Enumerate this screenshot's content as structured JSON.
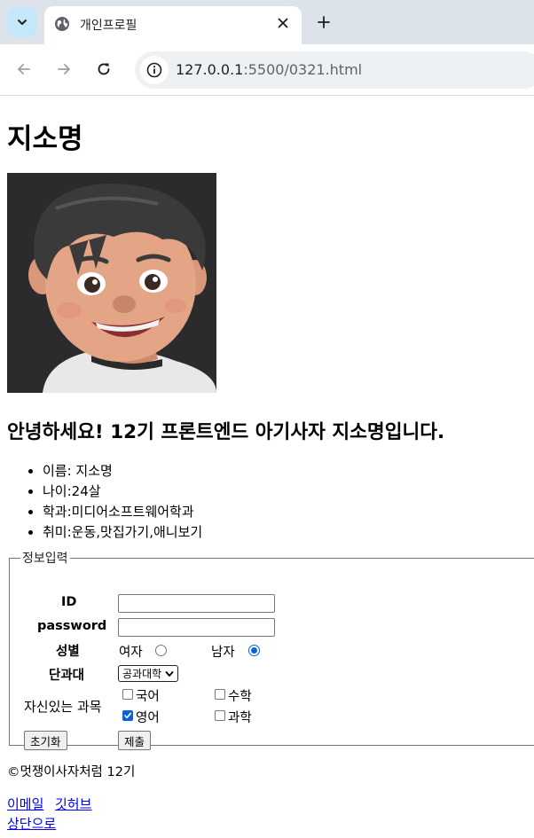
{
  "browser": {
    "tab_title": "개인프로필",
    "url_host": "127.0.0.1",
    "url_rest": ":5500/0321.html"
  },
  "profile": {
    "name": "지소명",
    "greeting": "안녕하세요! 12기 프론트엔드 아기사자 지소명입니다.",
    "info": [
      "이름: 지소명",
      "나이:24살",
      "학과:미디어소프트웨어학과",
      "취미:운동,맛집가기,애니보기"
    ]
  },
  "form": {
    "legend": "정보입력",
    "id_label": "ID",
    "id_value": "",
    "password_label": "password",
    "password_value": "",
    "gender_label": "성별",
    "gender_options": [
      "여자",
      "남자"
    ],
    "gender_selected": "남자",
    "college_label": "단과대",
    "college_selected": "공과대학",
    "subjects_label": "자신있는 과목",
    "subjects": [
      {
        "label": "국어",
        "checked": false
      },
      {
        "label": "수학",
        "checked": false
      },
      {
        "label": "영어",
        "checked": true
      },
      {
        "label": "과학",
        "checked": false
      }
    ],
    "reset_label": "초기화",
    "submit_label": "제출"
  },
  "footer": {
    "copyright": "©멋쟁이사자처럼 12기",
    "email_link": "이메일",
    "github_link": "깃허브",
    "top_link": "상단으로"
  },
  "colors": {
    "accent": "#0b63d6",
    "link": "#0000ee",
    "tabbar_bg": "#dde3ea"
  }
}
